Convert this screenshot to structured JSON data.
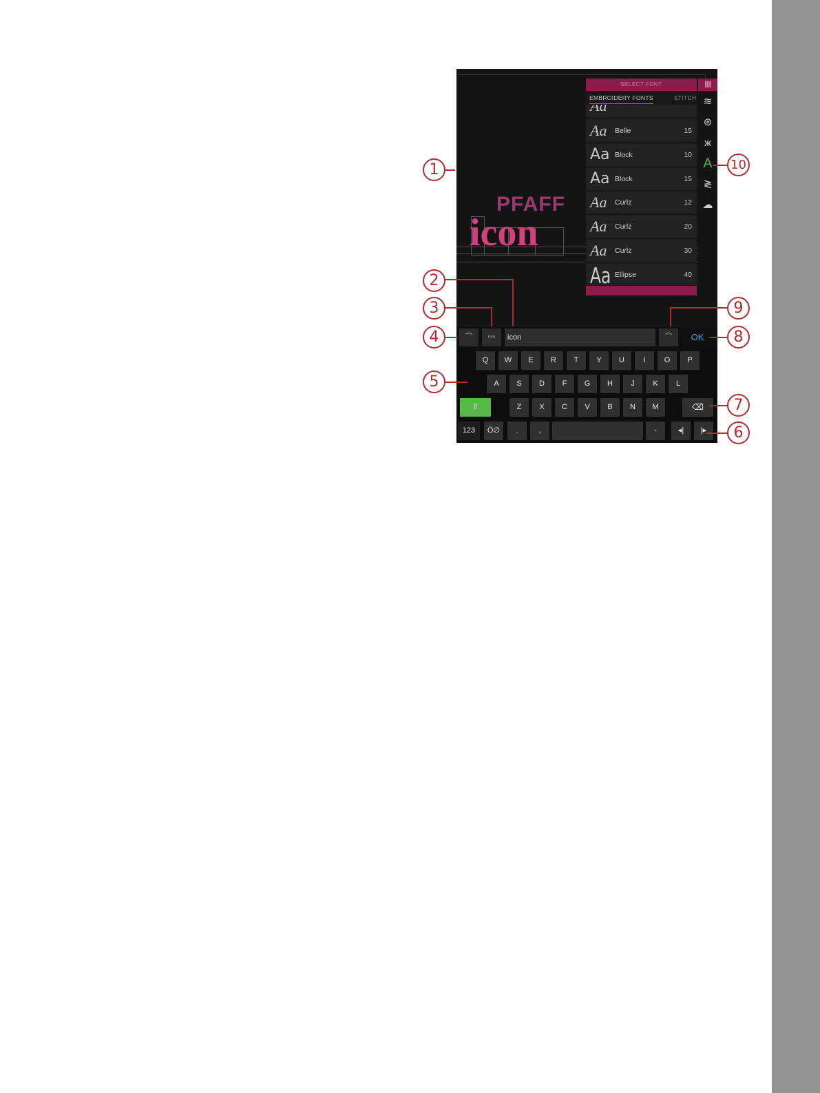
{
  "font_panel": {
    "header": "SELECT FONT",
    "tabs": [
      "EMBROIDERY FONTS",
      "STITCH"
    ],
    "fonts": [
      {
        "sample": "Aa",
        "name": "Belle",
        "size": "15",
        "style": "script"
      },
      {
        "sample": "Aa",
        "name": "Block",
        "size": "10",
        "style": "sans"
      },
      {
        "sample": "Aa",
        "name": "Block",
        "size": "15",
        "style": "sans"
      },
      {
        "sample": "Aa",
        "name": "Curlz",
        "size": "12",
        "style": "script"
      },
      {
        "sample": "Aa",
        "name": "Curlz",
        "size": "20",
        "style": "script"
      },
      {
        "sample": "Aa",
        "name": "Curlz",
        "size": "30",
        "style": "script"
      },
      {
        "sample": "Aa",
        "name": "Ellipse",
        "size": "40",
        "style": "tall"
      }
    ]
  },
  "canvas": {
    "top_text": "PFAFF",
    "main_text": "icon"
  },
  "input_bar": {
    "text_value": "icon",
    "ok_label": "OK"
  },
  "keyboard": {
    "row1": [
      "Q",
      "W",
      "E",
      "R",
      "T",
      "Y",
      "U",
      "I",
      "O",
      "P"
    ],
    "row2": [
      "A",
      "S",
      "D",
      "F",
      "G",
      "H",
      "J",
      "K",
      "L"
    ],
    "row3": [
      "Z",
      "X",
      "C",
      "V",
      "B",
      "N",
      "M"
    ],
    "bottom": {
      "numbers": "123",
      "dot": ".",
      "comma": ",",
      "dash": "-"
    }
  },
  "callouts": [
    "1",
    "2",
    "3",
    "4",
    "5",
    "6",
    "7",
    "8",
    "9",
    "10"
  ],
  "colors": {
    "accent": "#8a1d4c",
    "active": "#4fc24a",
    "ok": "#4d9ee0",
    "callout": "#b42a2e"
  }
}
